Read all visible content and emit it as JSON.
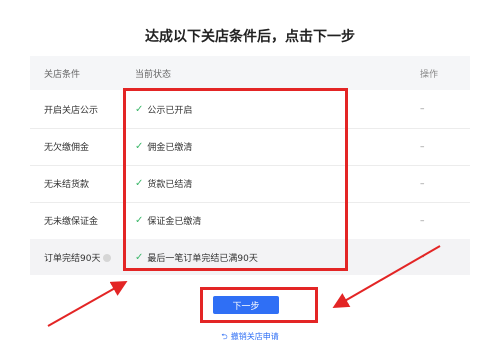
{
  "page": {
    "title": "达成以下关店条件后，点击下一步"
  },
  "table": {
    "headers": [
      "关店条件",
      "当前状态",
      "操作"
    ],
    "rows": [
      {
        "condition": "开启关店公示",
        "status": "公示已开启",
        "action": "–",
        "info": false
      },
      {
        "condition": "无欠缴佣金",
        "status": "佣金已缴清",
        "action": "–",
        "info": false
      },
      {
        "condition": "无未结货款",
        "status": "货款已结清",
        "action": "–",
        "info": false
      },
      {
        "condition": "无未缴保证金",
        "status": "保证金已缴清",
        "action": "–",
        "info": false
      },
      {
        "condition": "订单完结90天",
        "status": "最后一笔订单完结已满90天",
        "action": "–",
        "info": true
      }
    ]
  },
  "buttons": {
    "next_label": "下一步",
    "cancel_label": "撤销关店申请"
  },
  "colors": {
    "accent": "#2f6ff5",
    "highlight": "#e32525",
    "success": "#3db86b"
  }
}
